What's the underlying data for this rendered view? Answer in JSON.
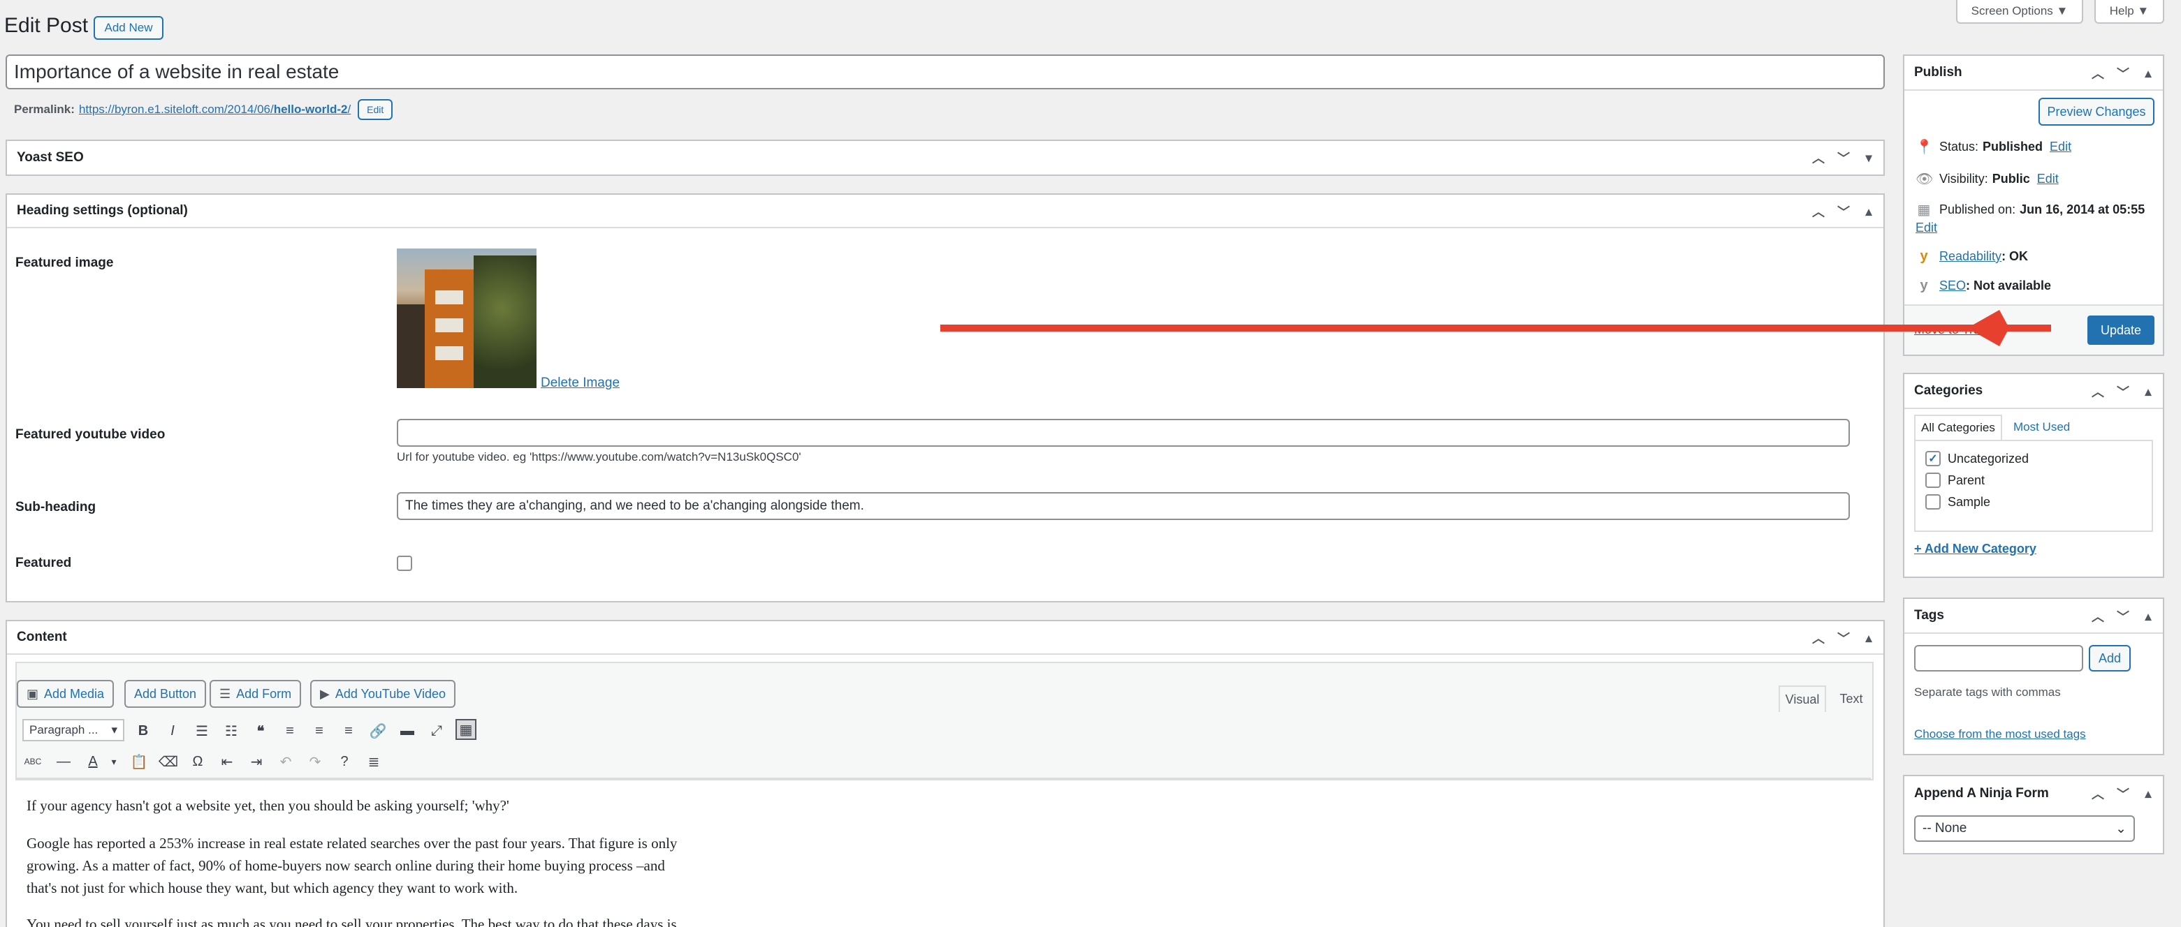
{
  "header": {
    "title": "Edit Post",
    "add_new": "Add New",
    "screen_options": "Screen Options ▼",
    "help": "Help ▼"
  },
  "post": {
    "title": "Importance of a website in real estate",
    "permalink_label": "Permalink:",
    "permalink_base": "https://byron.e1.siteloft.com/2014/06/",
    "permalink_slug": "hello-world-2",
    "permalink_end": "/",
    "permalink_edit": "Edit"
  },
  "yoast": {
    "title": "Yoast SEO"
  },
  "heading_settings": {
    "title": "Heading settings (optional)",
    "featured_image_label": "Featured image",
    "delete_image": "Delete Image",
    "youtube_label": "Featured youtube video",
    "youtube_value": "",
    "youtube_help": "Url for youtube video. eg 'https://www.youtube.com/watch?v=N13uSk0QSC0'",
    "subheading_label": "Sub-heading",
    "subheading_value": "The times they are a'changing, and we need to be a'changing alongside them.",
    "featured_label": "Featured"
  },
  "content": {
    "title": "Content",
    "add_media": "Add Media",
    "add_button": "Add Button",
    "add_form": "Add Form",
    "add_youtube": "Add YouTube Video",
    "tab_visual": "Visual",
    "tab_text": "Text",
    "format_select": "Paragraph ...",
    "paragraphs": [
      "If your agency hasn't got a website yet, then you should be asking yourself; 'why?'",
      "Google has reported a 253% increase in real estate related searches over the past four years. That figure is only",
      "growing. As a matter of fact, 90% of home-buyers now search online during their home buying process –and",
      "that's not just for which house they want, but which agency they want to work with.",
      "You need to sell yourself just as much as you need to sell your properties. The best way to do that these days is"
    ]
  },
  "publish": {
    "title": "Publish",
    "preview": "Preview Changes",
    "status_label": "Status:",
    "status_value": "Published",
    "visibility_label": "Visibility:",
    "visibility_value": "Public",
    "published_label": "Published on:",
    "published_value": "Jun 16, 2014 at 05:55",
    "edit": "Edit",
    "readability_link": "Readability",
    "readability_value": ": OK",
    "seo_link": "SEO",
    "seo_value": ": Not available",
    "trash": "Move to Trash",
    "update": "Update"
  },
  "categories": {
    "title": "Categories",
    "tab_all": "All Categories",
    "tab_most": "Most Used",
    "items": [
      {
        "label": "Uncategorized",
        "checked": "✓"
      },
      {
        "label": "Parent",
        "checked": ""
      },
      {
        "label": "Sample",
        "checked": ""
      }
    ],
    "add_new": "+ Add New Category"
  },
  "tags": {
    "title": "Tags",
    "add": "Add",
    "help": "Separate tags with commas",
    "choose": "Choose from the most used tags"
  },
  "ninja": {
    "title": "Append A Ninja Form",
    "select_value": "-- None"
  },
  "colors": {
    "accent": "#2271b1",
    "arrow": "#e8402f"
  }
}
